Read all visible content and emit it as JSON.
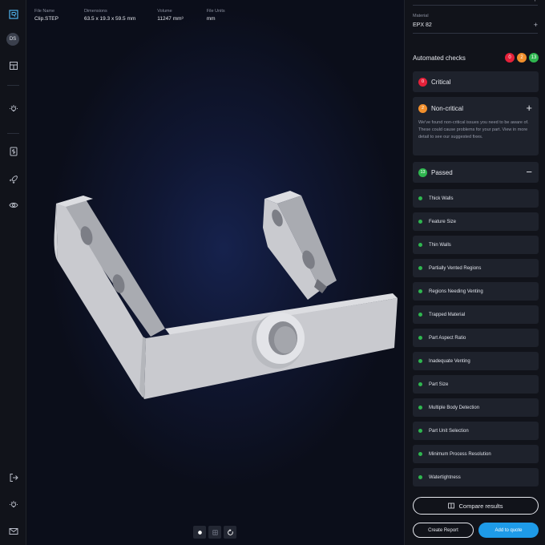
{
  "user": {
    "initials": "DS"
  },
  "file_info": {
    "file_name_label": "File Name",
    "file_name": "Clip.STEP",
    "dimensions_label": "Dimensions",
    "dimensions": "63.5 x 19.3 x 59.5 mm",
    "volume_label": "Volume",
    "volume": "11247 mm³",
    "units_label": "File Units",
    "units": "mm"
  },
  "material": {
    "label": "Material",
    "value": "EPX 82"
  },
  "automated_checks": {
    "title": "Automated checks",
    "counts": {
      "critical": "0",
      "noncritical": "2",
      "passed": "13"
    },
    "critical": {
      "count": "0",
      "title": "Critical"
    },
    "noncritical": {
      "count": "2",
      "title": "Non-critical",
      "description": "We've found non-critical issues you need to be aware of. These could cause problems for your part. View in more detail to see our suggested fixes."
    },
    "passed": {
      "count": "13",
      "title": "Passed",
      "items": [
        "Thick Walls",
        "Feature Size",
        "Thin Walls",
        "Partially Vented Regions",
        "Regions Needing Venting",
        "Trapped Material",
        "Part Aspect Ratio",
        "Inadequate Venting",
        "Part Size",
        "Multiple Body Detection",
        "Part Unit Selection",
        "Minimum Process Resolution",
        "Watertightness"
      ]
    }
  },
  "actions": {
    "compare": "Compare results",
    "create_report": "Create Report",
    "add_to_quote": "Add to quote"
  },
  "colors": {
    "critical": "#e5213a",
    "noncritical": "#f18f2c",
    "passed": "#2fb64f",
    "primary": "#1e9be8"
  }
}
